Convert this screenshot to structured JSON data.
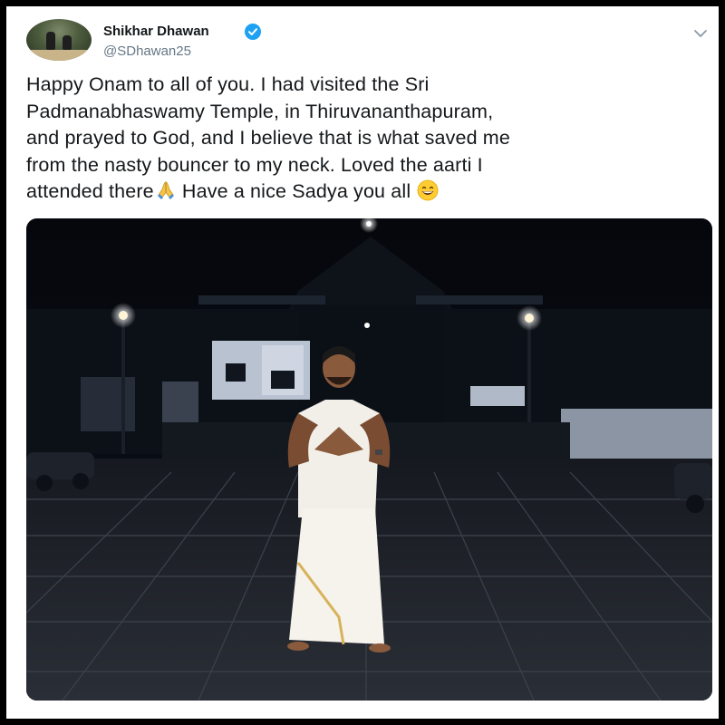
{
  "tweet": {
    "user_name": "Shikhar Dhawan",
    "handle": "@SDhawan25",
    "verified": true,
    "text_lines": [
      "Happy Onam to all of you. I had visited the Sri",
      "Padmanabhaswamy Temple, in Thiruvananthapuram,",
      "and prayed to God, and I believe that is what saved me",
      "from the nasty bouncer to my neck. Loved the aarti I",
      "attended there",
      "Have a nice Sadya you all"
    ],
    "emojis": [
      "folded-hands-emoji",
      "grinning-face-emoji"
    ]
  },
  "colors": {
    "verified_blue": "#1da1f2",
    "name_text": "#14171a",
    "handle_text": "#657786",
    "frame_border": "#000000"
  }
}
